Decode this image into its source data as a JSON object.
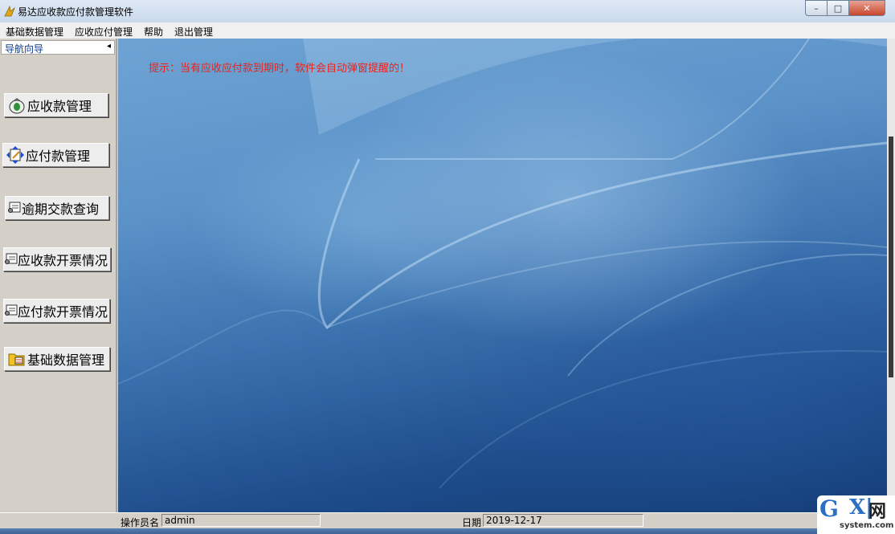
{
  "window": {
    "title": "易达应收款应付款管理软件",
    "minimize": "–",
    "restore": "□",
    "close": "✕"
  },
  "menu": {
    "items": [
      {
        "label": "基础数据管理"
      },
      {
        "label": "应收应付管理"
      },
      {
        "label": "帮助"
      },
      {
        "label": "退出管理"
      }
    ]
  },
  "nav": {
    "header": "导航向导",
    "collapse_icon": "◂",
    "buttons": [
      {
        "label": "应收款管理",
        "icon": "money-bag-icon"
      },
      {
        "label": "应付款管理",
        "icon": "payment-arrows-icon"
      },
      {
        "label": "逾期交款查询",
        "icon": "query-form-icon"
      },
      {
        "label": "应收款开票情况",
        "icon": "invoice-form-icon"
      },
      {
        "label": "应付款开票情况",
        "icon": "invoice-form-icon"
      },
      {
        "label": "基础数据管理",
        "icon": "folder-data-icon"
      }
    ]
  },
  "main": {
    "tip": "提示：当有应收应付款到期时，软件会自动弹窗提醒的！"
  },
  "status": {
    "operator_label": "操作员名",
    "operator_value": "admin",
    "date_label": "日期",
    "date_value": "2019-12-17"
  },
  "watermark": {
    "g": "G",
    "x": "X|",
    "wang": "网",
    "sub": "system.com"
  },
  "colors": {
    "tip_text": "#e8241c",
    "desktop_blue": "#3b71ae",
    "nav_panel": "#d4d0c8"
  }
}
